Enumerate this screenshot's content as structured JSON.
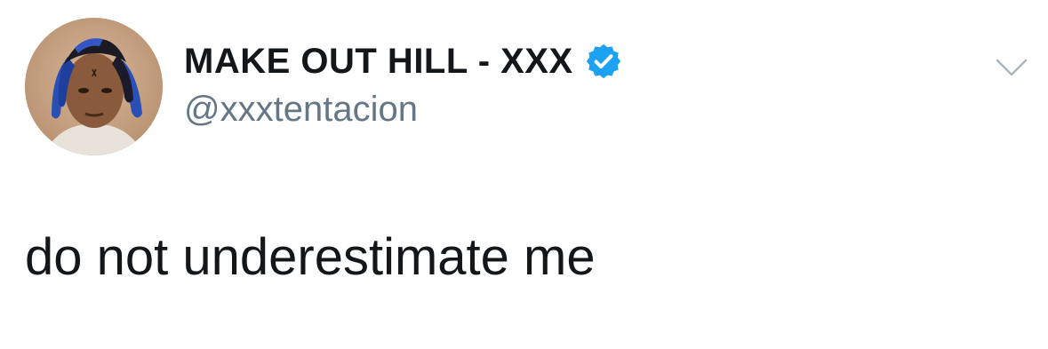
{
  "author": {
    "display_name": "MAKE OUT HILL - XXX",
    "handle": "@xxxtentacion",
    "verified": true,
    "avatar_icon": "profile-photo"
  },
  "tweet": {
    "text": "do not underestimate me"
  },
  "icons": {
    "verified": "verified-badge-icon",
    "menu": "chevron-down-icon"
  },
  "colors": {
    "verified_badge": "#1da1f2",
    "name_text": "#14171a",
    "handle_text": "#657786",
    "chevron": "#aab8c2",
    "background": "#ffffff"
  }
}
